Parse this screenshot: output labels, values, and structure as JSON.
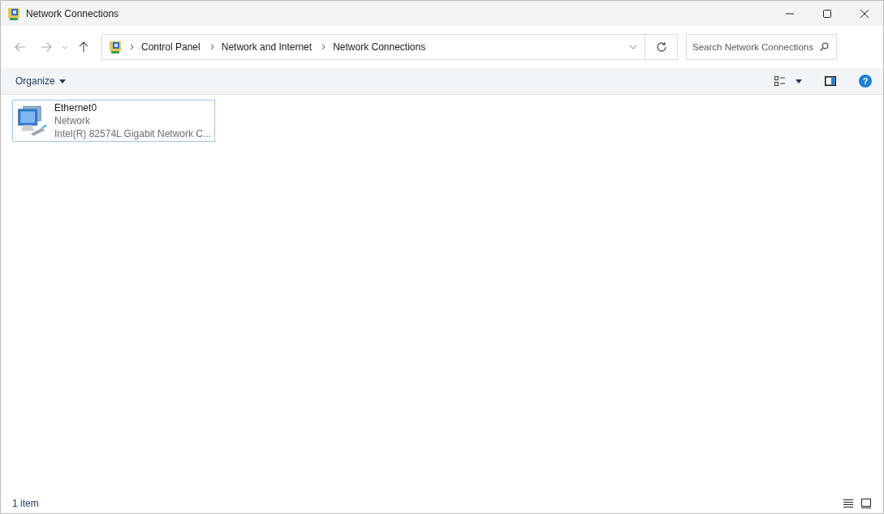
{
  "window": {
    "title": "Network Connections"
  },
  "breadcrumb": [
    "Control Panel",
    "Network and Internet",
    "Network Connections"
  ],
  "search": {
    "placeholder": "Search Network Connections"
  },
  "toolbar": {
    "organize": "Organize",
    "help": "?"
  },
  "items": [
    {
      "name": "Ethernet0",
      "status": "Network",
      "device": "Intel(R) 82574L Gigabit Network C...",
      "selected": true
    }
  ],
  "status_bar": {
    "count": "1 item"
  }
}
